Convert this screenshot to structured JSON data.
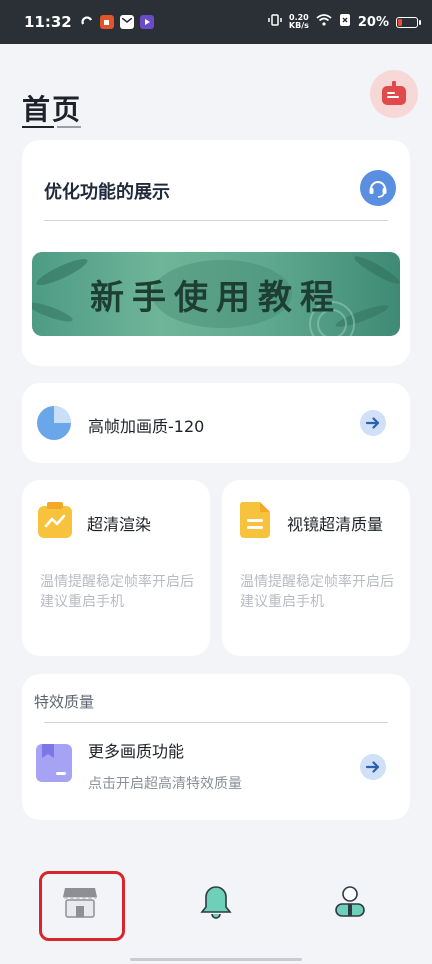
{
  "statusbar": {
    "time": "11:32",
    "net_speed_top": "0.20",
    "net_speed_bottom": "KB/s",
    "battery": "20%"
  },
  "page": {
    "title": "首页"
  },
  "main_card": {
    "heading": "优化功能的展示",
    "banner_text": "新手使用教程"
  },
  "frame_row": {
    "label": "高帧加画质-120"
  },
  "cards": [
    {
      "label": "超清渲染",
      "hint": "温情提醒稳定帧率开启后建议重启手机",
      "icon": "chart-doc-icon"
    },
    {
      "label": "视镜超清质量",
      "hint": "温情提醒稳定帧率开启后建议重启手机",
      "icon": "document-icon"
    }
  ],
  "effects": {
    "section_label": "特效质量",
    "title": "更多画质功能",
    "subtitle": "点击开启超高清特效质量"
  },
  "nav": {
    "items": [
      "store-icon",
      "bell-icon",
      "profile-icon"
    ],
    "selected_index": 0
  },
  "colors": {
    "accent_blue": "#5a8ee0",
    "highlight_red": "#d6262a",
    "banner_green": "#5ea88f"
  }
}
